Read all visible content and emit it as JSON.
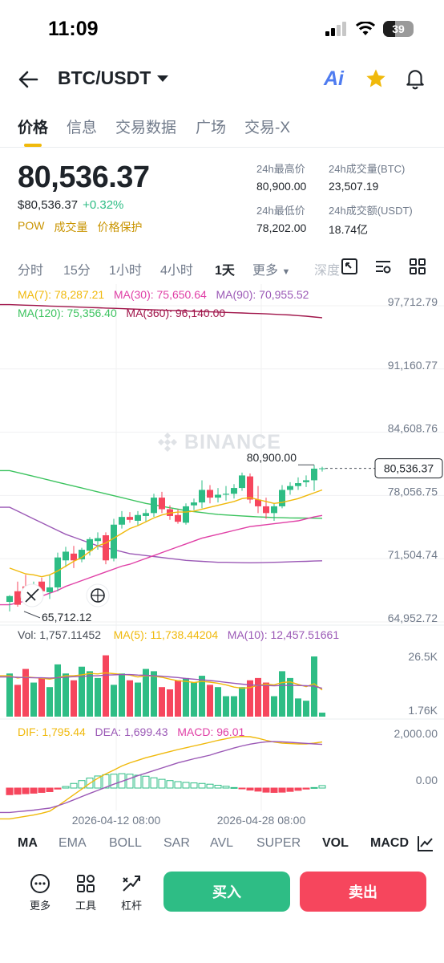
{
  "status": {
    "time": "11:09",
    "battery": "39"
  },
  "header": {
    "pair": "BTC/USDT",
    "ai_label": "Ai"
  },
  "tabs": [
    "价格",
    "信息",
    "交易数据",
    "广场",
    "交易-X"
  ],
  "price": {
    "last": "80,536.37",
    "usd": "$80,536.37",
    "change": "+0.32%",
    "tags": [
      "POW",
      "成交量",
      "价格保护"
    ]
  },
  "stats": {
    "high_label": "24h最高价",
    "high": "80,900.00",
    "vol_btc_label": "24h成交量(BTC)",
    "vol_btc": "23,507.19",
    "low_label": "24h最低价",
    "low": "78,202.00",
    "vol_usdt_label": "24h成交额(USDT)",
    "vol_usdt": "18.74亿"
  },
  "intervals": [
    "分时",
    "15分",
    "1小时",
    "4小时",
    "1天",
    "更多",
    "深度"
  ],
  "ma_legend": {
    "ma7": "MA(7): 78,287.21",
    "ma30": "MA(30): 75,650.64",
    "ma90": "MA(90): 70,955.52",
    "ma120": "MA(120): 75,356.40",
    "ma360": "MA(360): 96,140.00"
  },
  "colors": {
    "up": "#2ebd85",
    "down": "#f6465d",
    "ma7": "#f0b90b",
    "ma30": "#e040a6",
    "ma90": "#9b59b6",
    "ma120": "#3cc35f",
    "ma360": "#a0154a",
    "accent": "#f0b90b"
  },
  "watermark": "BINANCE",
  "vol_legend": {
    "vol": "Vol: 1,757.11452",
    "ma5": "MA(5): 11,738.44204",
    "ma10": "MA(10): 12,457.51661"
  },
  "macd_legend": {
    "dif": "DIF: 1,795.44",
    "dea": "DEA: 1,699.43",
    "macd": "MACD: 96.01"
  },
  "indicator_tabs": [
    "MA",
    "EMA",
    "BOLL",
    "SAR",
    "AVL",
    "SUPER",
    "VOL",
    "MACD"
  ],
  "bottom": {
    "more": "更多",
    "tools": "工具",
    "leverage": "杠杆",
    "buy": "买入",
    "sell": "卖出"
  },
  "chart_data": {
    "type": "candlestick",
    "price_axis": [
      "97,712.79",
      "91,160.77",
      "84,608.76",
      "78,056.75",
      "71,504.74",
      "64,952.72"
    ],
    "price_range": [
      64952.72,
      97712.79
    ],
    "high_label": "80,900.00",
    "low_label": "65,712.12",
    "last_price_label": "80,536.37",
    "volume_axis": [
      "26.5K",
      "1.76K"
    ],
    "macd_axis": [
      "2,000.00",
      "0.00"
    ],
    "x_labels": [
      "2026-04-12 08:00",
      "2026-04-28 08:00"
    ],
    "candles": [
      {
        "o": 66700,
        "h": 67400,
        "l": 65712,
        "c": 67300
      },
      {
        "o": 67800,
        "h": 68800,
        "l": 66200,
        "c": 66400
      },
      {
        "o": 68300,
        "h": 69500,
        "l": 66600,
        "c": 67400
      },
      {
        "o": 67000,
        "h": 68800,
        "l": 66500,
        "c": 68200
      },
      {
        "o": 68800,
        "h": 69200,
        "l": 67400,
        "c": 67800
      },
      {
        "o": 67700,
        "h": 69500,
        "l": 67000,
        "c": 68200
      },
      {
        "o": 68200,
        "h": 71800,
        "l": 67800,
        "c": 71300
      },
      {
        "o": 71000,
        "h": 72400,
        "l": 70300,
        "c": 71900
      },
      {
        "o": 71700,
        "h": 72500,
        "l": 70200,
        "c": 71000
      },
      {
        "o": 71100,
        "h": 72300,
        "l": 70800,
        "c": 72100
      },
      {
        "o": 72000,
        "h": 73400,
        "l": 71500,
        "c": 73200
      },
      {
        "o": 73000,
        "h": 73900,
        "l": 72100,
        "c": 73300
      },
      {
        "o": 73600,
        "h": 73900,
        "l": 70600,
        "c": 71000
      },
      {
        "o": 71200,
        "h": 75300,
        "l": 70900,
        "c": 74700
      },
      {
        "o": 74700,
        "h": 76100,
        "l": 74300,
        "c": 75500
      },
      {
        "o": 75500,
        "h": 76000,
        "l": 74900,
        "c": 75200
      },
      {
        "o": 75100,
        "h": 76100,
        "l": 74600,
        "c": 75700
      },
      {
        "o": 75600,
        "h": 76300,
        "l": 75000,
        "c": 75900
      },
      {
        "o": 75900,
        "h": 77900,
        "l": 75500,
        "c": 77500
      },
      {
        "o": 77500,
        "h": 78100,
        "l": 75900,
        "c": 76300
      },
      {
        "o": 76300,
        "h": 76700,
        "l": 75200,
        "c": 75600
      },
      {
        "o": 75700,
        "h": 76300,
        "l": 74800,
        "c": 75000
      },
      {
        "o": 74900,
        "h": 76900,
        "l": 74700,
        "c": 76600
      },
      {
        "o": 76700,
        "h": 77400,
        "l": 76200,
        "c": 77000
      },
      {
        "o": 77000,
        "h": 79300,
        "l": 76400,
        "c": 78300
      },
      {
        "o": 78300,
        "h": 78800,
        "l": 76900,
        "c": 77500
      },
      {
        "o": 77500,
        "h": 78500,
        "l": 77000,
        "c": 77800
      },
      {
        "o": 77800,
        "h": 78700,
        "l": 77200,
        "c": 77900
      },
      {
        "o": 77900,
        "h": 78900,
        "l": 77400,
        "c": 78500
      },
      {
        "o": 78500,
        "h": 80100,
        "l": 78200,
        "c": 79800
      },
      {
        "o": 79700,
        "h": 80000,
        "l": 76900,
        "c": 77300
      },
      {
        "o": 77300,
        "h": 78700,
        "l": 75900,
        "c": 76600
      },
      {
        "o": 76600,
        "h": 77500,
        "l": 75300,
        "c": 75900
      },
      {
        "o": 75900,
        "h": 76900,
        "l": 75100,
        "c": 76600
      },
      {
        "o": 76600,
        "h": 78800,
        "l": 76400,
        "c": 78300
      },
      {
        "o": 78300,
        "h": 79100,
        "l": 77800,
        "c": 78700
      },
      {
        "o": 78700,
        "h": 79600,
        "l": 78300,
        "c": 79000
      },
      {
        "o": 79100,
        "h": 79800,
        "l": 78600,
        "c": 79300
      },
      {
        "o": 79300,
        "h": 80900,
        "l": 78200,
        "c": 80500
      },
      {
        "o": 80500,
        "h": 80700,
        "l": 80200,
        "c": 80536
      }
    ],
    "ma7": [
      70200,
      69900,
      69600,
      69500,
      69300,
      69500,
      69900,
      70400,
      70900,
      71300,
      71900,
      72500,
      72800,
      73300,
      73800,
      74300,
      74600,
      75000,
      75400,
      75700,
      75900,
      76000,
      76000,
      76100,
      76300,
      76500,
      76700,
      76900,
      77100,
      77400,
      77500,
      77300,
      77100,
      76900,
      77000,
      77200,
      77400,
      77700,
      78000,
      78300
    ],
    "ma30": [
      66400,
      66600,
      66800,
      67000,
      67300,
      67600,
      67900,
      68300,
      68600,
      68900,
      69200,
      69500,
      69800,
      70100,
      70400,
      70600,
      70900,
      71200,
      71500,
      71800,
      72100,
      72400,
      72700,
      73000,
      73300,
      73500,
      73700,
      73900,
      74100,
      74300,
      74500,
      74600,
      74700,
      74800,
      74900,
      75000,
      75100,
      75300,
      75500,
      75650
    ],
    "ma90": [
      76500,
      76100,
      75700,
      75300,
      74900,
      74500,
      74100,
      73700,
      73400,
      73100,
      72800,
      72500,
      72300,
      72100,
      71900,
      71700,
      71600,
      71500,
      71400,
      71300,
      71200,
      71100,
      71000,
      70950,
      70900,
      70850,
      70800,
      70800,
      70780,
      70760,
      70750,
      70760,
      70780,
      70800,
      70820,
      70850,
      70880,
      70900,
      70930,
      70955
    ],
    "ma120": [
      80300,
      80100,
      79900,
      79700,
      79500,
      79300,
      79100,
      78900,
      78700,
      78500,
      78300,
      78100,
      77900,
      77700,
      77500,
      77300,
      77100,
      76900,
      76750,
      76600,
      76450,
      76300,
      76150,
      76050,
      75950,
      75850,
      75750,
      75700,
      75650,
      75600,
      75550,
      75500,
      75470,
      75440,
      75420,
      75400,
      75390,
      75380,
      75370,
      75356
    ],
    "ma360": [
      97500,
      97470,
      97440,
      97410,
      97380,
      97350,
      97320,
      97290,
      97260,
      97230,
      97200,
      97170,
      97140,
      97110,
      97080,
      97050,
      97020,
      96990,
      96960,
      96930,
      96900,
      96870,
      96840,
      96810,
      96780,
      96750,
      96720,
      96690,
      96660,
      96630,
      96600,
      96570,
      96540,
      96500,
      96460,
      96420,
      96360,
      96300,
      96220,
      96140
    ],
    "volume": [
      19000,
      14000,
      21000,
      15000,
      17000,
      13000,
      23000,
      19000,
      16000,
      22000,
      20000,
      17000,
      27000,
      14000,
      19000,
      16000,
      15000,
      21000,
      20000,
      13000,
      12000,
      16000,
      17000,
      15000,
      18000,
      14000,
      13000,
      9000,
      9000,
      13000,
      16000,
      17000,
      15000,
      9000,
      20000,
      17000,
      8000,
      7000,
      26500,
      1757
    ],
    "vol_ma5": [
      18000,
      17000,
      17500,
      17200,
      16900,
      16500,
      17200,
      18000,
      18000,
      18400,
      19000,
      18800,
      19300,
      18900,
      18600,
      18300,
      17500,
      18000,
      17800,
      17300,
      16500,
      15800,
      15500,
      15000,
      15500,
      15200,
      14700,
      14000,
      13000,
      12500,
      12800,
      13800,
      14300,
      14000,
      15000,
      15300,
      14200,
      13200,
      14500,
      11738
    ],
    "vol_ma10": [
      17500,
      17300,
      17200,
      17100,
      17100,
      17000,
      17100,
      17400,
      17600,
      17700,
      18000,
      18000,
      18300,
      18400,
      18500,
      18500,
      18300,
      18200,
      18000,
      17800,
      17500,
      17200,
      16800,
      16500,
      16200,
      15900,
      15500,
      15100,
      14700,
      14300,
      14000,
      13800,
      13700,
      13600,
      13700,
      13800,
      13700,
      13600,
      13400,
      12457
    ],
    "macd_hist": [
      -260,
      -240,
      -220,
      -200,
      -170,
      -140,
      -40,
      60,
      180,
      290,
      390,
      470,
      520,
      540,
      560,
      540,
      500,
      460,
      400,
      340,
      290,
      250,
      220,
      200,
      180,
      150,
      110,
      70,
      20,
      -20,
      -80,
      -120,
      -160,
      -170,
      -160,
      -130,
      -90,
      -40,
      20,
      96
    ],
    "dif": [
      -1200,
      -1150,
      -1100,
      -1050,
      -980,
      -900,
      -700,
      -480,
      -260,
      -40,
      180,
      380,
      550,
      700,
      860,
      980,
      1080,
      1180,
      1260,
      1340,
      1420,
      1500,
      1570,
      1640,
      1710,
      1780,
      1860,
      1920,
      1980,
      2010,
      2000,
      1940,
      1860,
      1790,
      1750,
      1730,
      1720,
      1720,
      1750,
      1795
    ],
    "dea": [
      -950,
      -920,
      -890,
      -860,
      -820,
      -780,
      -690,
      -580,
      -460,
      -330,
      -210,
      -90,
      30,
      150,
      260,
      370,
      480,
      580,
      680,
      780,
      880,
      980,
      1060,
      1140,
      1210,
      1280,
      1380,
      1470,
      1560,
      1640,
      1710,
      1760,
      1800,
      1810,
      1800,
      1780,
      1760,
      1740,
      1720,
      1699
    ]
  }
}
